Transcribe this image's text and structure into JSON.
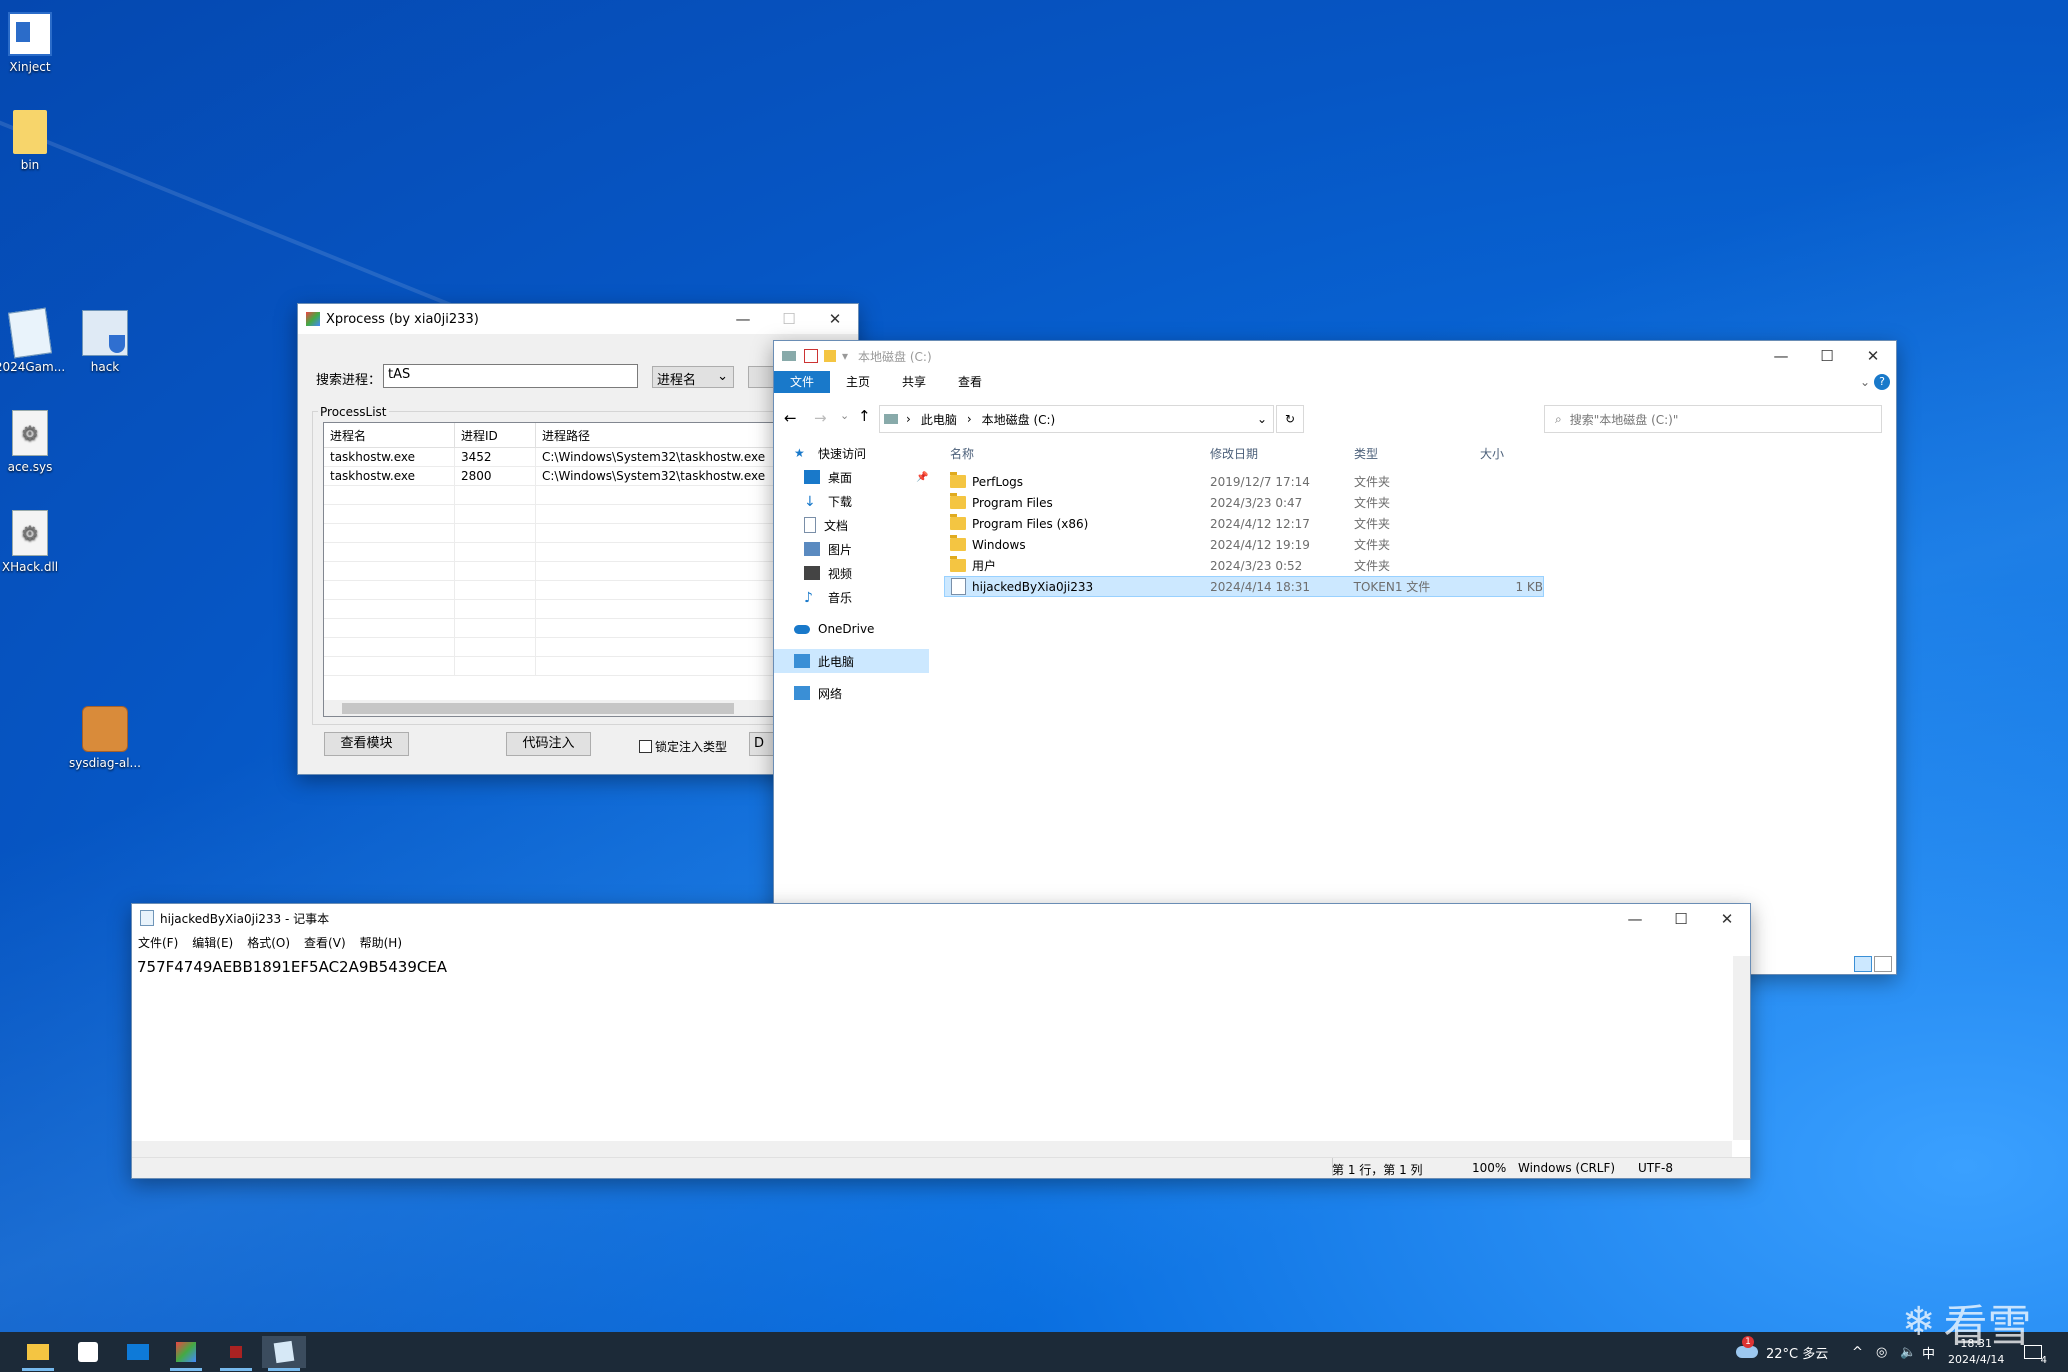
{
  "desktop": {
    "icons": [
      {
        "label": "Xinject"
      },
      {
        "label": "bin"
      },
      {
        "label": "2024Gam..."
      },
      {
        "label": "hack"
      },
      {
        "label": "ace.sys"
      },
      {
        "label": "XHack.dll"
      },
      {
        "label": "sysdiag-al..."
      }
    ]
  },
  "xprocess": {
    "title": "Xprocess (by xia0ji233)",
    "search_label": "搜索进程：",
    "search_value": "tAS",
    "search_mode": "进程名",
    "group_label": "ProcessList",
    "columns": [
      "进程名",
      "进程ID",
      "进程路径"
    ],
    "rows": [
      [
        "taskhostw.exe",
        "3452",
        "C:\\Windows\\System32\\taskhostw.exe"
      ],
      [
        "taskhostw.exe",
        "2800",
        "C:\\Windows\\System32\\taskhostw.exe"
      ]
    ],
    "btn_modules": "查看模块",
    "btn_inject": "代码注入",
    "lock_label": "锁定注入类型",
    "btn_partial": "D"
  },
  "explorer": {
    "title": "本地磁盘 (C:)",
    "tabs": [
      "文件",
      "主页",
      "共享",
      "查看"
    ],
    "breadcrumb": [
      "此电脑",
      "本地磁盘 (C:)"
    ],
    "search_placeholder": "搜索\"本地磁盘 (C:)\"",
    "nav": [
      "快速访问",
      "桌面",
      "下载",
      "文档",
      "图片",
      "视频",
      "音乐",
      "OneDrive",
      "此电脑",
      "网络"
    ],
    "columns": [
      "名称",
      "修改日期",
      "类型",
      "大小"
    ],
    "files": [
      {
        "name": "PerfLogs",
        "date": "2019/12/7 17:14",
        "type": "文件夹",
        "size": ""
      },
      {
        "name": "Program Files",
        "date": "2024/3/23 0:47",
        "type": "文件夹",
        "size": ""
      },
      {
        "name": "Program Files (x86)",
        "date": "2024/4/12 12:17",
        "type": "文件夹",
        "size": ""
      },
      {
        "name": "Windows",
        "date": "2024/4/12 19:19",
        "type": "文件夹",
        "size": ""
      },
      {
        "name": "用户",
        "date": "2024/3/23 0:52",
        "type": "文件夹",
        "size": ""
      },
      {
        "name": "hijackedByXia0ji233",
        "date": "2024/4/14 18:31",
        "type": "TOKEN1 文件",
        "size": "1 KB"
      }
    ]
  },
  "notepad": {
    "title": "hijackedByXia0ji233 - 记事本",
    "menu": [
      "文件(F)",
      "编辑(E)",
      "格式(O)",
      "查看(V)",
      "帮助(H)"
    ],
    "content": "757F4749AEBB1891EF5AC2A9B5439CEA",
    "status_pos": "第 1 行，第 1 列",
    "status_zoom": "100%",
    "status_eol": "Windows (CRLF)",
    "status_enc": "UTF-8"
  },
  "taskbar": {
    "weather": "22°C  多云",
    "ime": "中",
    "time": "18:31",
    "date": "2024/4/14",
    "notif_count": "4",
    "badge": "1"
  },
  "watermark": "看雪"
}
